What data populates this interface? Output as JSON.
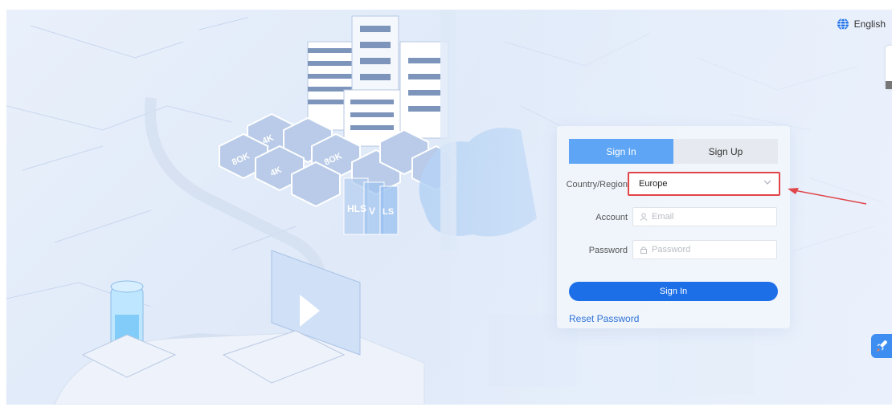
{
  "header": {
    "language": "English"
  },
  "auth": {
    "tabs": [
      {
        "label": "Sign In",
        "active": true
      },
      {
        "label": "Sign Up",
        "active": false
      }
    ],
    "region": {
      "label": "Country/Region",
      "value": "Europe"
    },
    "account": {
      "label": "Account",
      "placeholder": "Email"
    },
    "password": {
      "label": "Password",
      "placeholder": "Password"
    },
    "submit_label": "Sign In",
    "reset_label": "Reset Password"
  },
  "illustration": {
    "hex_labels": [
      "4K",
      "8OK",
      "4K",
      "8OK"
    ],
    "card_labels": [
      "HLS",
      "V",
      "LS"
    ]
  },
  "colors": {
    "primary": "#1d6fe8",
    "tab_active": "#5ea6f5",
    "highlight": "#e0454a",
    "link": "#2f73d6"
  },
  "icons": {
    "language": "globe-icon",
    "account": "user-icon",
    "password": "lock-icon",
    "region": "chevron-down-icon",
    "float": "rocket-icon",
    "annotation": "red-arrow-icon"
  }
}
